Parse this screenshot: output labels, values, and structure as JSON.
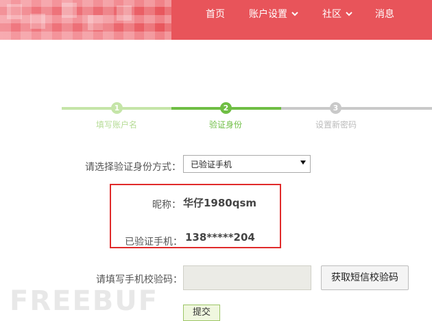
{
  "colors": {
    "topbar": "#e8545a",
    "step_done": "#c5e5a8",
    "step_active": "#6fbe44",
    "step_todo": "#c9c9c9",
    "highlight_border": "#e02a2a"
  },
  "nav": {
    "items": [
      {
        "label": "首页",
        "has_dropdown": false
      },
      {
        "label": "账户设置",
        "has_dropdown": true
      },
      {
        "label": "社区",
        "has_dropdown": true
      },
      {
        "label": "消息",
        "has_dropdown": false
      }
    ]
  },
  "steps": [
    {
      "number": "1",
      "label": "填写账户名",
      "state": "done"
    },
    {
      "number": "2",
      "label": "验证身份",
      "state": "active"
    },
    {
      "number": "3",
      "label": "设置新密码",
      "state": "todo"
    }
  ],
  "form": {
    "method_label": "请选择验证身份方式：",
    "method_selected": "已验证手机",
    "nickname_label": "昵称：",
    "nickname_value": "华仔1980qsm",
    "phone_label": "已验证手机：",
    "phone_value": "138*****204",
    "code_label": "请填写手机校验码：",
    "code_value": "",
    "sms_button": "获取短信校验码",
    "submit_button": "提交"
  },
  "watermark": "FREEBUF"
}
